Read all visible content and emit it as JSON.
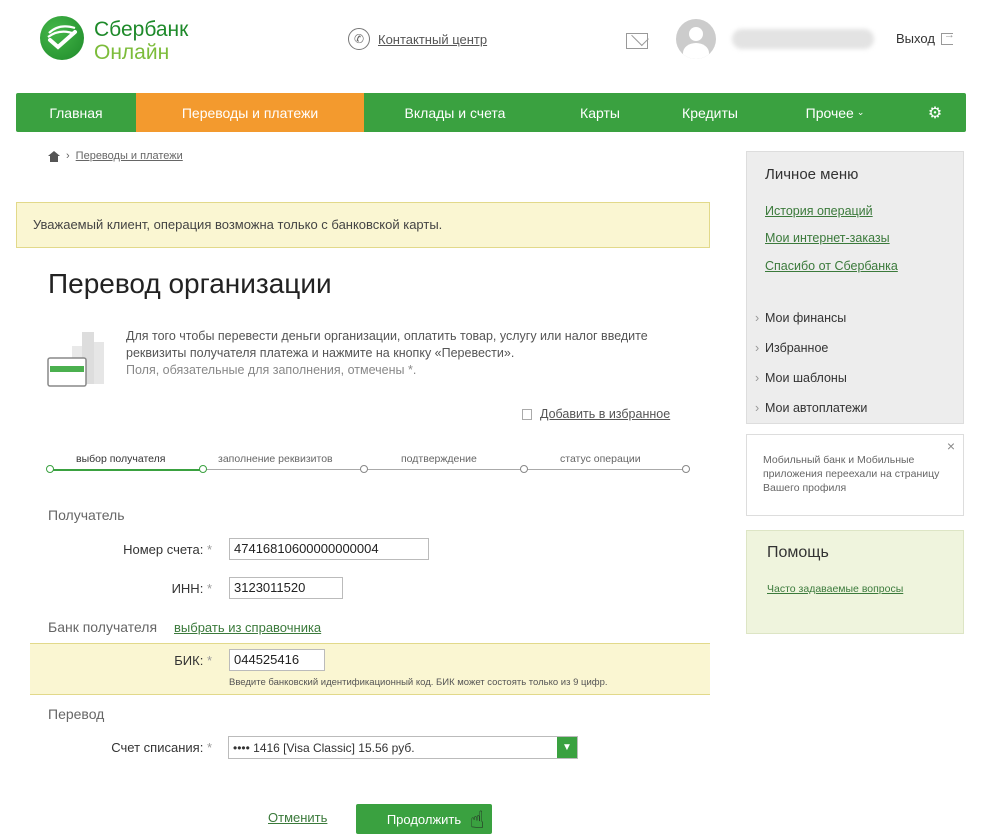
{
  "brand": {
    "line1": "Сбербанк",
    "line2": "Онлайн",
    "color": "#1e8a2a"
  },
  "header": {
    "contact_center": "Контактный центр",
    "logout": "Выход"
  },
  "nav": {
    "items": [
      "Главная",
      "Переводы и платежи",
      "Вклады и счета",
      "Карты",
      "Кредиты",
      "Прочее"
    ],
    "active_index": 1,
    "active_color": "#f39a2e",
    "bar_color": "#3aa140"
  },
  "breadcrumb": {
    "current": "Переводы и платежи"
  },
  "notice": {
    "text": "Уважаемый клиент, операция возможна только с банковской карты."
  },
  "page": {
    "title": "Перевод организации",
    "description": "Для того чтобы перевести деньги организации, оплатить товар, услугу или налог введите реквизиты получателя платежа и нажмите на кнопку «Перевести».",
    "required_note": "Поля, обязательные для заполнения, отмечены *.",
    "add_favorite": "Добавить в избранное"
  },
  "steps": [
    "выбор получателя",
    "заполнение реквизитов",
    "подтверждение",
    "статус операции"
  ],
  "form": {
    "recipient_section": "Получатель",
    "account_label": "Номер счета:",
    "account_value": "47416810600000000004",
    "inn_label": "ИНН:",
    "inn_value": "3123011520",
    "bank_section": "Банк получателя",
    "pick_from_directory": "выбрать из справочника",
    "bik_label": "БИК:",
    "bik_value": "044525416",
    "bik_hint": "Введите банковский идентификационный код. БИК может состоять только из 9 цифр.",
    "transfer_section": "Перевод",
    "debit_label": "Счет списания:",
    "debit_value": "•••• 1416 [Visa Classic] 15.56 руб.",
    "required_mark": "*"
  },
  "actions": {
    "cancel": "Отменить",
    "continue": "Продолжить"
  },
  "sidebar": {
    "menu_title": "Личное меню",
    "links": [
      "История операций",
      "Мои интернет-заказы",
      "Спасибо от Сбербанка"
    ],
    "items": [
      "Мои финансы",
      "Избранное",
      "Мои шаблоны",
      "Мои автоплатежи"
    ],
    "promo": "Мобильный банк и Мобильные приложения переехали на страницу Вашего профиля",
    "promo_close": "×",
    "help_title": "Помощь",
    "help_link": "Часто задаваемые вопросы"
  }
}
